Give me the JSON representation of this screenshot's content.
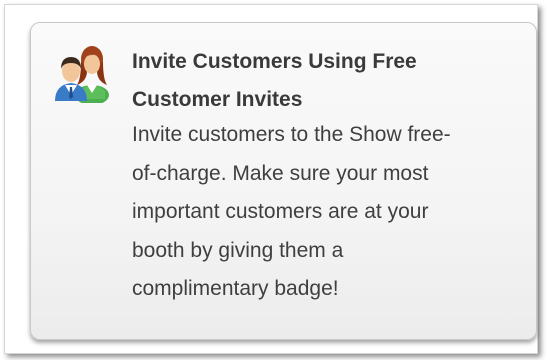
{
  "card": {
    "icon": "customers-icon",
    "title": "Invite Customers Using Free\nCustomer Invites",
    "description": "Invite customers to the Show free-\nof-charge. Make sure your most\nimportant customers are at your\nbooth by giving them a\ncomplimentary badge!"
  },
  "colors": {
    "title_text": "#3a3a3a",
    "body_text": "#3f3f3f",
    "card_border": "#c9c9c9",
    "icon_green": "#4caf50",
    "icon_blue": "#3a7bc8",
    "icon_hair_dark": "#3b2a1e",
    "icon_hair_red": "#a0431c"
  }
}
